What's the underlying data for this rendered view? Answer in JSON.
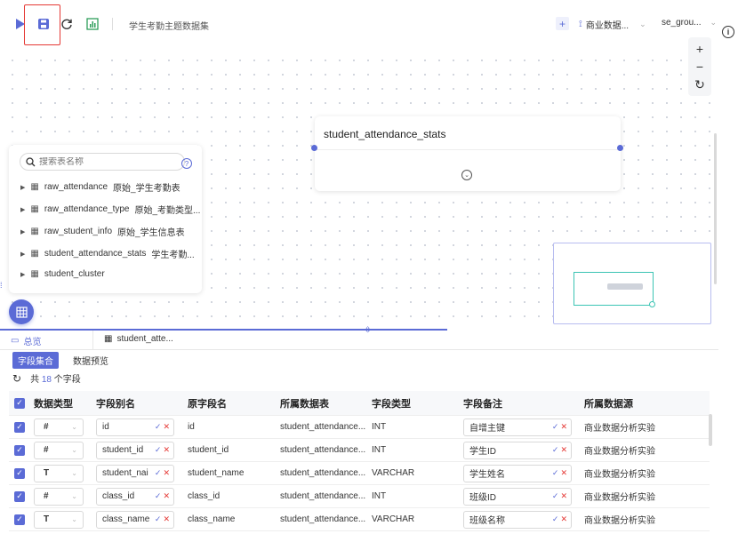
{
  "toolbar": {
    "dataset_name": "学生考勤主题数据集",
    "add_label": "+",
    "source_select": "商业数据...",
    "group_select": "se_grou...",
    "info_label": "i"
  },
  "canvas": {
    "node_title": "student_attendance_stats",
    "zoom_in": "+",
    "zoom_out": "−",
    "zoom_reset": "↻"
  },
  "table_panel": {
    "search_placeholder": "搜索表名称",
    "help": "?",
    "items": [
      {
        "name": "raw_attendance",
        "desc": "原始_学生考勤表"
      },
      {
        "name": "raw_attendance_type",
        "desc": "原始_考勤类型..."
      },
      {
        "name": "raw_student_info",
        "desc": "原始_学生信息表"
      },
      {
        "name": "student_attendance_stats",
        "desc": "学生考勤..."
      },
      {
        "name": "student_cluster",
        "desc": ""
      }
    ]
  },
  "bottom": {
    "tab_overview": "总览",
    "tab_table": "student_atte...",
    "subtab_fields": "字段集合",
    "subtab_preview": "数据预览",
    "count_prefix": "共",
    "count_value": "18",
    "count_suffix": "个字段",
    "headers": [
      "数据类型",
      "字段别名",
      "原字段名",
      "所属数据表",
      "字段类型",
      "字段备注",
      "所属数据源"
    ],
    "rows": [
      {
        "type": "#",
        "alias": "id",
        "orig": "id",
        "table": "student_attendance...",
        "ftype": "INT",
        "remark": "自增主键",
        "source": "商业数据分析实验"
      },
      {
        "type": "#",
        "alias": "student_id",
        "orig": "student_id",
        "table": "student_attendance...",
        "ftype": "INT",
        "remark": "学生ID",
        "source": "商业数据分析实验"
      },
      {
        "type": "T",
        "alias": "student_nai",
        "orig": "student_name",
        "table": "student_attendance...",
        "ftype": "VARCHAR",
        "remark": "学生姓名",
        "source": "商业数据分析实验"
      },
      {
        "type": "#",
        "alias": "class_id",
        "orig": "class_id",
        "table": "student_attendance...",
        "ftype": "INT",
        "remark": "班级ID",
        "source": "商业数据分析实验"
      },
      {
        "type": "T",
        "alias": "class_name",
        "orig": "class_name",
        "table": "student_attendance...",
        "ftype": "VARCHAR",
        "remark": "班级名称",
        "source": "商业数据分析实验"
      }
    ]
  },
  "colors": {
    "accent": "#5b6bd6",
    "highlight": "#e53935",
    "teal": "#3cc4b4"
  }
}
